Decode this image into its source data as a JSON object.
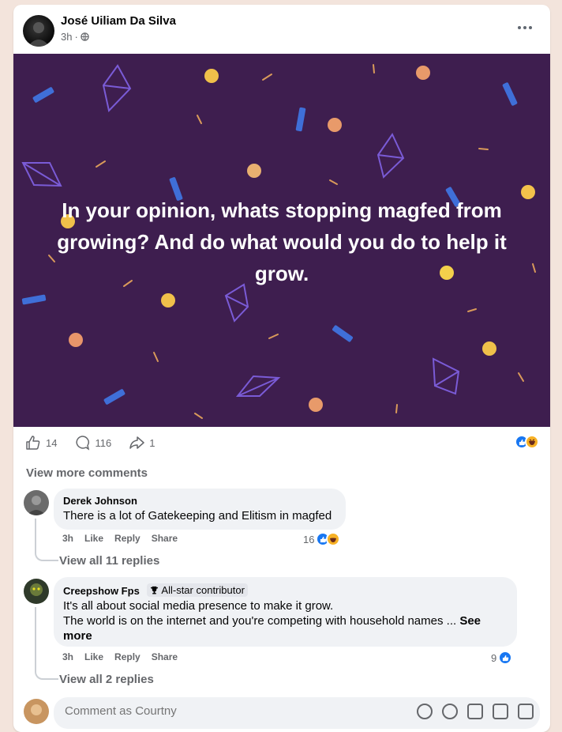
{
  "post": {
    "author": "José Uiliam Da Silva",
    "time": "3h",
    "separator": "·",
    "banner_text": "In your opinion, whats stopping magfed from growing? And do what would you do to help it grow.",
    "banner_color": "#3e1e4f"
  },
  "stats": {
    "likes": "14",
    "comments": "116",
    "shares": "1",
    "reactions": [
      "like-icon",
      "haha-icon"
    ]
  },
  "view_more_comments": "View more comments",
  "comments": [
    {
      "name": "Derek Johnson",
      "text": "There is a lot of Gatekeeping and Elitism in magfed",
      "time": "3h",
      "like": "Like",
      "reply": "Reply",
      "share": "Share",
      "reaction_count": "16",
      "replies": "View all 11 replies"
    },
    {
      "name": "Creepshow Fps",
      "badge": "All-star contributor",
      "text_line1": "It's all about social media presence to make it grow.",
      "text_line2": "The world is on the internet and you're competing with household names ... ",
      "see_more": "See more",
      "time": "3h",
      "like": "Like",
      "reply": "Reply",
      "share": "Share",
      "reaction_count": "9",
      "replies": "View all 2 replies"
    }
  ],
  "composer": {
    "placeholder": "Comment as Courtny"
  },
  "colors": {
    "like_blue": "#1877f2",
    "haha_yellow": "#f7b125",
    "muted_text": "#65676b"
  }
}
